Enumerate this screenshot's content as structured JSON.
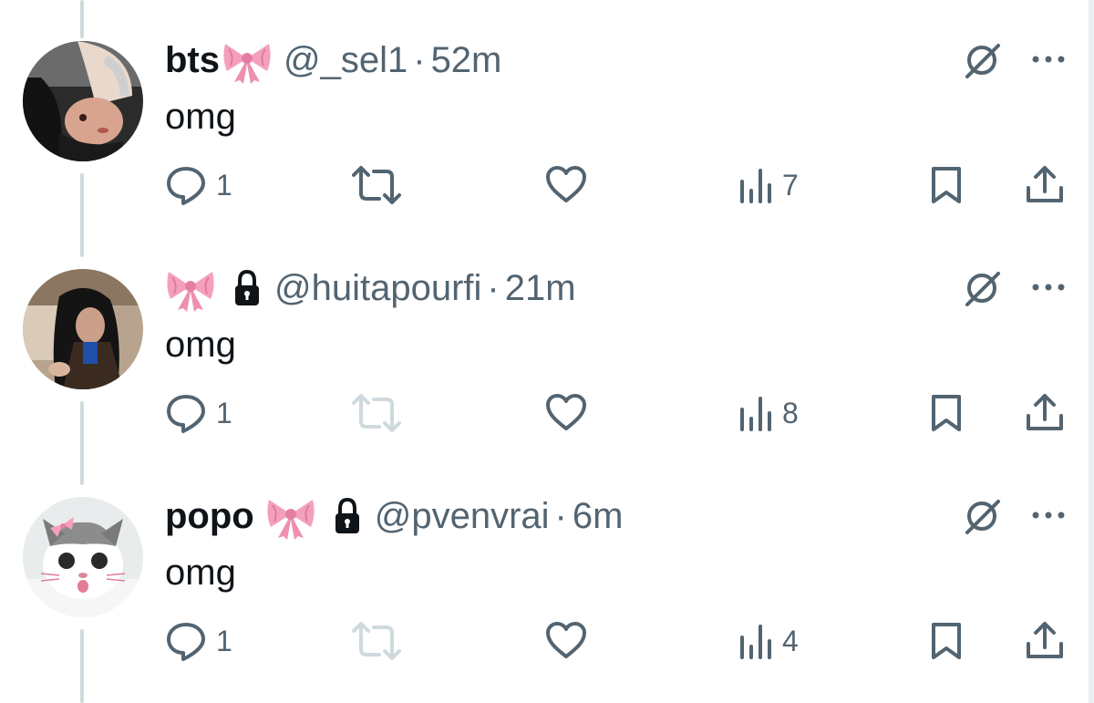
{
  "tweets": [
    {
      "name": "bts",
      "has_bow": true,
      "locked": false,
      "handle": "@_sel1",
      "separator": "·",
      "time": "52m",
      "text": "omg",
      "replies": "1",
      "views": "7",
      "avatar": "avatar-girl-selfie",
      "retweet_disabled": false
    },
    {
      "name": "",
      "has_bow": true,
      "locked": true,
      "handle": "@huitapourfi",
      "separator": "·",
      "time": "21m",
      "text": "omg",
      "replies": "1",
      "views": "8",
      "avatar": "avatar-girl-dark-hair",
      "retweet_disabled": true
    },
    {
      "name": "popo",
      "has_bow": true,
      "locked": true,
      "handle": "@pvenvrai",
      "separator": "·",
      "time": "6m",
      "text": "omg",
      "replies": "1",
      "views": "4",
      "avatar": "avatar-cat-with-bow",
      "retweet_disabled": true
    }
  ],
  "colors": {
    "text": "#0f1419",
    "secondary": "#536471",
    "thread_line": "#cfd9de",
    "disabled_icon": "#cfd9de",
    "bow_pink": "#f4a0bd"
  }
}
